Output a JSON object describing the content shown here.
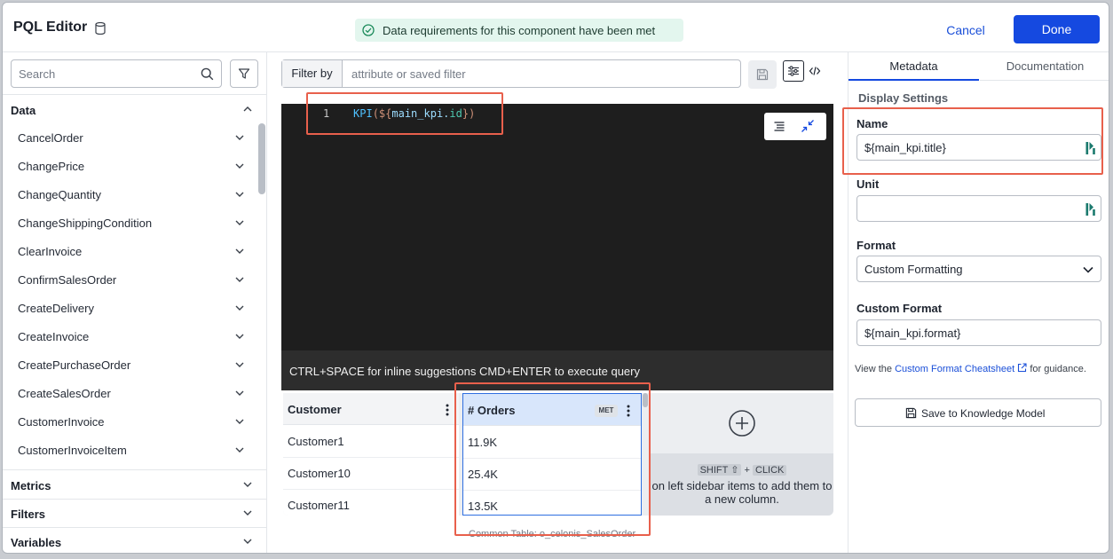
{
  "header": {
    "title": "PQL Editor",
    "banner": "Data requirements for this component have been met",
    "cancel_label": "Cancel",
    "done_label": "Done"
  },
  "sidebar": {
    "search_placeholder": "Search",
    "data_section": "Data",
    "items": [
      {
        "label": "CancelOrder"
      },
      {
        "label": "ChangePrice"
      },
      {
        "label": "ChangeQuantity"
      },
      {
        "label": "ChangeShippingCondition"
      },
      {
        "label": "ClearInvoice"
      },
      {
        "label": "ConfirmSalesOrder"
      },
      {
        "label": "CreateDelivery"
      },
      {
        "label": "CreateInvoice"
      },
      {
        "label": "CreatePurchaseOrder"
      },
      {
        "label": "CreateSalesOrder"
      },
      {
        "label": "CustomerInvoice"
      },
      {
        "label": "CustomerInvoiceItem"
      }
    ],
    "sections": [
      {
        "label": "Metrics"
      },
      {
        "label": "Filters"
      },
      {
        "label": "Variables"
      }
    ]
  },
  "filter_bar": {
    "label": "Filter by",
    "placeholder": "attribute or saved filter"
  },
  "editor": {
    "line_number": "1",
    "code_fn": "KPI",
    "code_open": "(${",
    "code_var": "main_kpi",
    "code_dot": ".",
    "code_prop": "id",
    "code_close": "})",
    "hint": "CTRL+SPACE for inline suggestions CMD+ENTER to execute query"
  },
  "table": {
    "columns": [
      {
        "header": "Customer",
        "cells": [
          "Customer1",
          "Customer10",
          "Customer11"
        ]
      },
      {
        "header": "# Orders",
        "badge": "MET",
        "cells": [
          "11.9K",
          "25.4K",
          "13.5K"
        ]
      }
    ],
    "add_tip_key1": "SHIFT ⇧",
    "add_tip_plus": "+",
    "add_tip_key2": "CLICK",
    "add_tip_text": "on left sidebar items to add them to a new column.",
    "common_table": "Common Table: o_celonis_SalesOrder"
  },
  "right_panel": {
    "tabs": [
      {
        "label": "Metadata",
        "active": true
      },
      {
        "label": "Documentation",
        "active": false
      }
    ],
    "display_settings": "Display Settings",
    "name_label": "Name",
    "name_value": "${main_kpi.title}",
    "unit_label": "Unit",
    "unit_value": "",
    "format_label": "Format",
    "format_value": "Custom Formatting",
    "custom_format_label": "Custom Format",
    "custom_format_value": "${main_kpi.format}",
    "help_prefix": "View the",
    "help_link": "Custom Format Cheatsheet",
    "help_suffix": "for guidance.",
    "save_km_label": "Save to Knowledge Model"
  },
  "colors": {
    "accent": "#1549e0",
    "highlight": "#e8604c",
    "banner_bg": "#e3f6ee",
    "editor_bg": "#1e1e1e"
  }
}
